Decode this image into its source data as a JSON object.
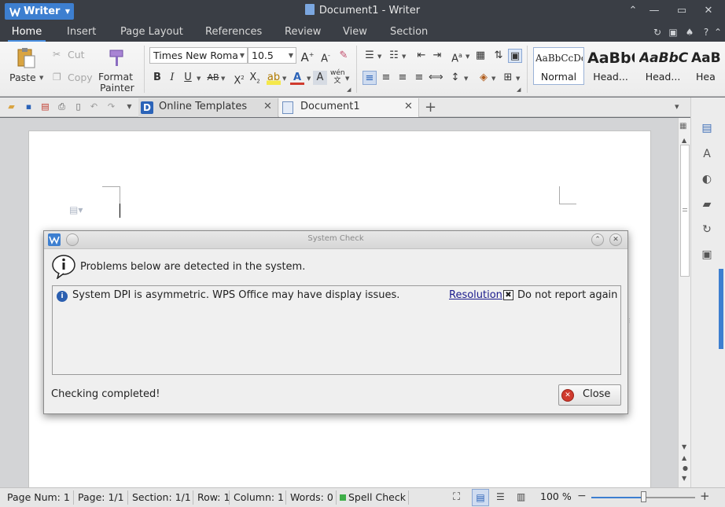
{
  "app": {
    "name": "Writer",
    "window_title": "Document1 - Writer"
  },
  "ribbon_tabs": [
    "Home",
    "Insert",
    "Page Layout",
    "References",
    "Review",
    "View",
    "Section"
  ],
  "clipboard": {
    "paste": "Paste",
    "cut": "Cut",
    "copy": "Copy",
    "format_painter_1": "Format",
    "format_painter_2": "Painter"
  },
  "font": {
    "name": "Times New Roma",
    "size": "10.5"
  },
  "styles": [
    {
      "preview": "AaBbCcDd",
      "label": "Normal"
    },
    {
      "preview": "AaBbC",
      "label": "Head..."
    },
    {
      "preview": "AaBbC",
      "label": "Head..."
    },
    {
      "preview": "AaB",
      "label": "Hea"
    }
  ],
  "doc_tabs": [
    {
      "label": "Online Templates"
    },
    {
      "label": "Document1"
    }
  ],
  "dialog": {
    "title": "System Check",
    "header": "Problems below are detected in the system.",
    "item_text": "System DPI is asymmetric. WPS Office may have display issues.",
    "resolution_link": "Resolution",
    "do_not_report": "Do not report again",
    "status": "Checking completed!",
    "close": "Close"
  },
  "status_bar": {
    "page_num": "Page Num: 1",
    "page": "Page: 1/1",
    "section": "Section: 1/1",
    "row": "Row: 1",
    "column": "Column: 1",
    "words": "Words: 0",
    "spell_check": "Spell Check",
    "zoom": "100 %"
  },
  "zoom_level": 0.5,
  "colors": {
    "accent": "#3d7fd0",
    "titlebar": "#3a3e45",
    "error": "#d03b2e"
  }
}
